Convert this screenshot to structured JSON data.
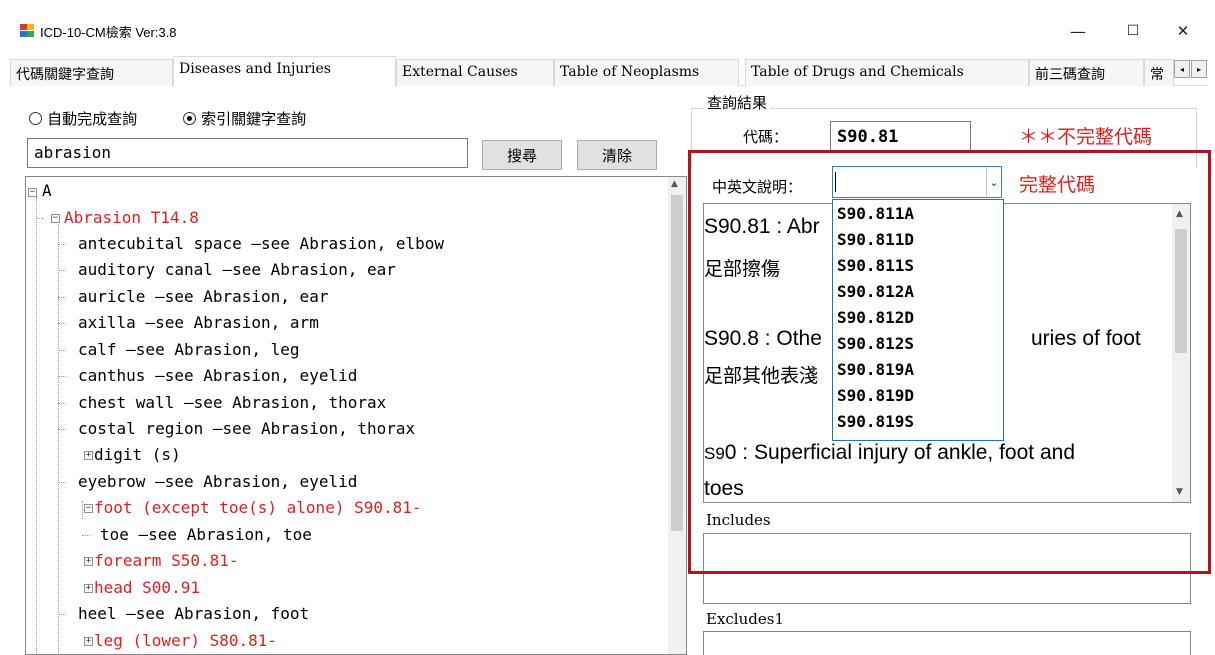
{
  "window": {
    "title": "ICD-10-CM檢索  Ver:3.8",
    "minimize_glyph": "—",
    "maximize_glyph": "☐",
    "close_glyph": "✕"
  },
  "tabs": [
    {
      "label": "代碼關鍵字查詢",
      "active": false
    },
    {
      "label": "Diseases and Injuries",
      "active": true
    },
    {
      "label": "External Causes",
      "active": false
    },
    {
      "label": "Table of Neoplasms",
      "active": false
    },
    {
      "label": "Table of Drugs and Chemicals",
      "active": false
    },
    {
      "label": "前三碼查詢",
      "active": false
    },
    {
      "label": "常",
      "active": false
    }
  ],
  "tab_scroll": {
    "left": "◂",
    "right": "▸"
  },
  "search": {
    "radio_autocomplete": "自動完成查詢",
    "radio_index": "索引關鍵字查詢",
    "selected_mode": "index",
    "value": "abrasion",
    "search_button": "搜尋",
    "clear_button": "清除"
  },
  "tree": {
    "root": "A",
    "parent": "Abrasion  T14.8",
    "items": [
      "antecubital space  —see Abrasion, elbow",
      "auditory canal  —see Abrasion, ear",
      "auricle  —see Abrasion, ear",
      "axilla  —see Abrasion, arm",
      "calf  —see Abrasion, leg",
      "canthus  —see Abrasion, eyelid",
      "chest wall  —see Abrasion, thorax",
      "costal region  —see Abrasion, thorax",
      "digit (s)",
      "eyebrow  —see Abrasion, eyelid",
      "foot (except toe(s) alone) S90.81-",
      "toe  —see Abrasion, toe",
      "forearm  S50.81-",
      "head  S00.91",
      "heel  —see Abrasion, foot",
      "leg (lower) S80.81-"
    ]
  },
  "result": {
    "group_title": "查詢結果",
    "code_label": "代碼：",
    "code_value": "S90.81",
    "incomplete_note": "＊＊不完整代碼",
    "desc_label": "中英文說明：",
    "combo_value": "",
    "combo_arrow": "⌄",
    "complete_note": "完整代碼",
    "dropdown_options": [
      "S90.811A",
      "S90.811D",
      "S90.811S",
      "S90.812A",
      "S90.812D",
      "S90.812S",
      "S90.819A",
      "S90.819D",
      "S90.819S"
    ],
    "desc_lines": {
      "l1_code": "S90.81 : Abr",
      "l2_zh": "足部擦傷",
      "l3_a": "S90.8 : Othe",
      "l3_b": "uries of foot",
      "l4_zh": "足部其他表淺",
      "l5_a": "S9",
      "l5_b": "0 : Superficial injury of ankle, foot and",
      "l6": "toes"
    },
    "includes_label": "Includes",
    "excludes_label": "Excludes1"
  },
  "colors": {
    "accent_red": "#b2141b",
    "text_red": "#e02020",
    "focus_blue": "#1e6fd0"
  }
}
